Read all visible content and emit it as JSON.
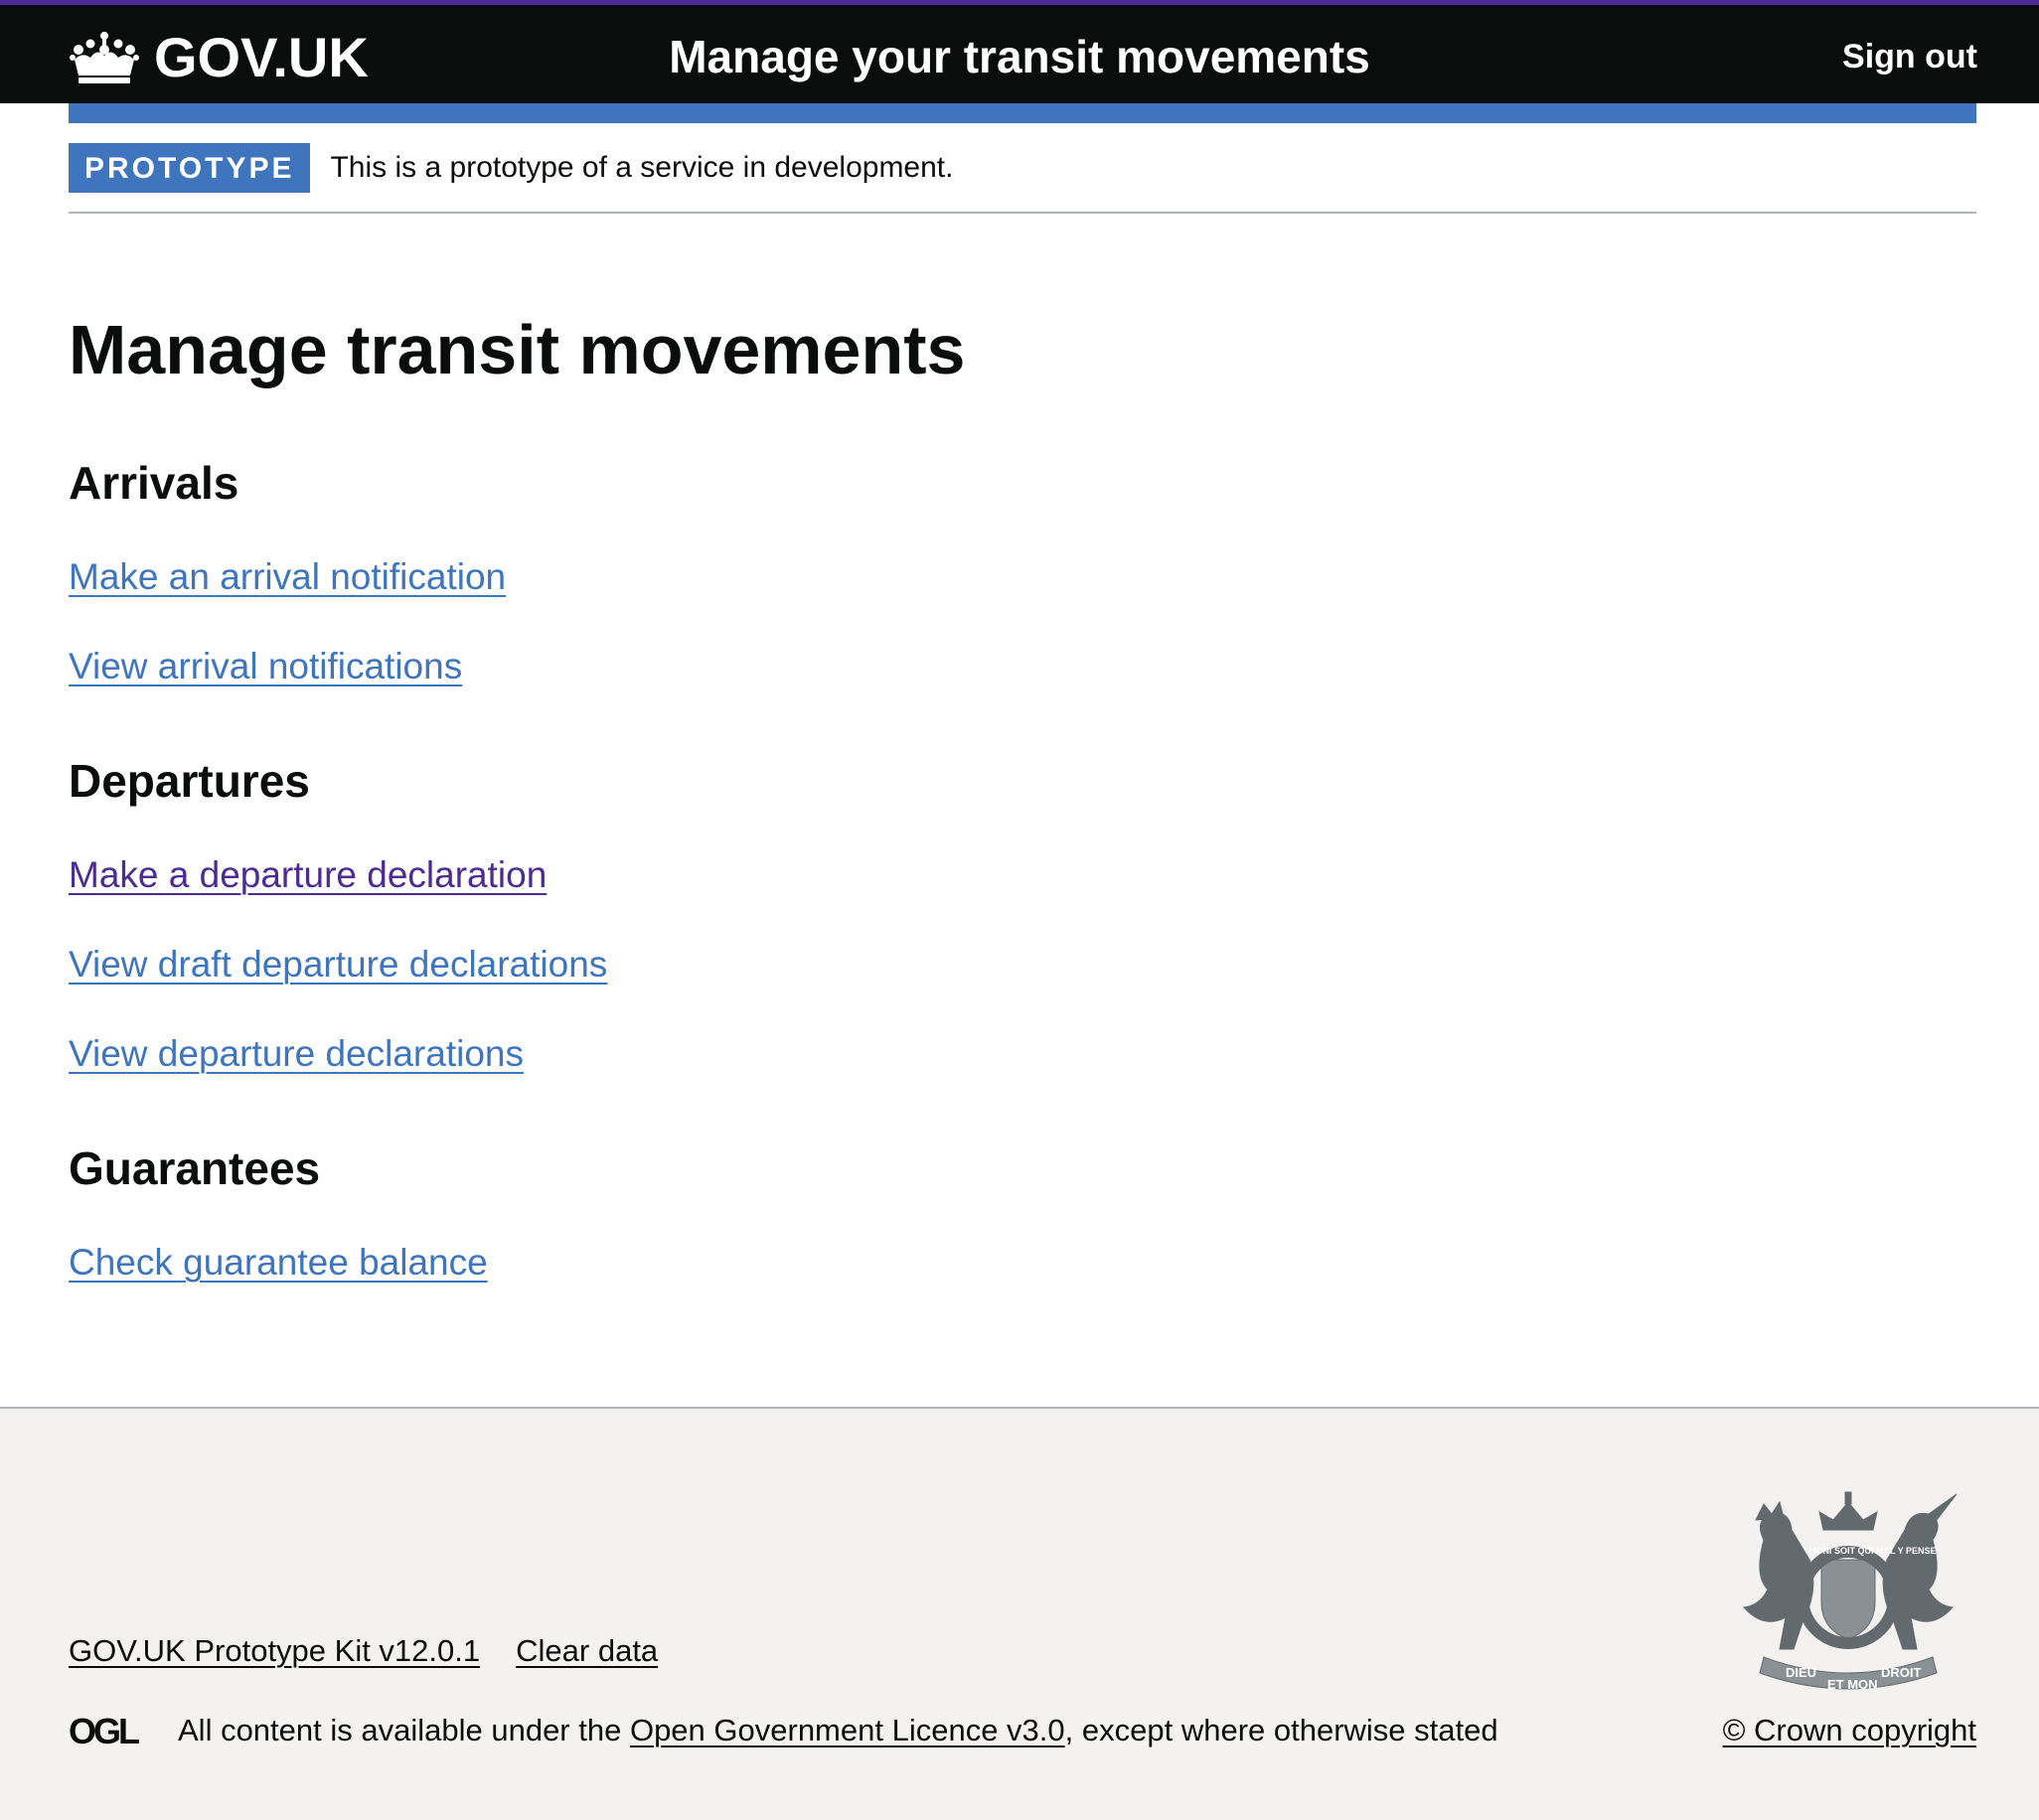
{
  "header": {
    "logo_text": "GOV.UK",
    "service_name": "Manage your transit movements",
    "sign_out_label": "Sign out"
  },
  "phase_banner": {
    "tag": "PROTOTYPE",
    "text": "This is a prototype of a service in development."
  },
  "main": {
    "title": "Manage transit movements",
    "sections": [
      {
        "heading": "Arrivals",
        "links": [
          "Make an arrival notification",
          "View arrival notifications"
        ]
      },
      {
        "heading": "Departures",
        "links": [
          "Make a departure declaration",
          "View draft departure declarations",
          "View departure declarations"
        ]
      },
      {
        "heading": "Guarantees",
        "links": [
          "Check guarantee balance"
        ]
      }
    ]
  },
  "footer": {
    "meta_links": [
      "GOV.UK Prototype Kit v12.0.1",
      "Clear data"
    ],
    "licence_prefix": "All content is available under the ",
    "licence_link": "Open Government Licence v3.0",
    "licence_suffix": ", except where otherwise stated",
    "copyright": "© Crown copyright",
    "ogl_logo_text": "OGL",
    "crest_text": [
      "DIEU",
      "ET MON",
      "DROIT",
      "HONI SOIT QUI MAL Y PENSE"
    ]
  },
  "icons": {
    "logo": "crown-icon",
    "licence": "ogl-icon",
    "crest": "royal-coat-of-arms-icon"
  },
  "colors": {
    "header_bg": "#0b0c0c",
    "header_top_border": "#4c2c92",
    "accent_blue": "#3f75bd",
    "link": "#3f75bd",
    "visited_link": "#4c2c92",
    "footer_bg": "#f3f2f1",
    "text": "#0b0c0c"
  }
}
